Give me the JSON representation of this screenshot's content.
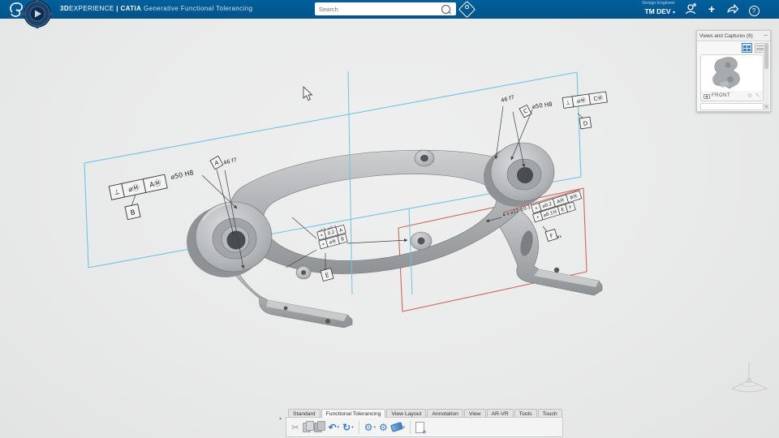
{
  "topbar": {
    "brand_bold": "3D",
    "brand_rest": "EXPERIENCE",
    "pipe": "|",
    "app": "CATIA",
    "module": "Generative Functional Tolerancing",
    "search_placeholder": "Search",
    "user_role": "Design Engineer",
    "user_name": "TM DEV",
    "user_caret": "▾"
  },
  "views_panel": {
    "title": "Views and Captures (6)",
    "minimize_glyph": "–",
    "capture_label": "FRONT",
    "scroll_down_glyph": "▾"
  },
  "ribbon": {
    "tabs": [
      "Standard",
      "Functional Tolerancing",
      "View Layout",
      "Annotation",
      "View",
      "AR-VR",
      "Tools",
      "Touch"
    ],
    "active_tab": "Functional Tolerancing",
    "collapse_glyph": "▾",
    "icons": {
      "cut_glyph": "✂",
      "undo_glyph": "↶",
      "update_glyph": "↻",
      "gear1_glyph": "⚙",
      "gear2_glyph": "⚙",
      "dropdown_glyph": "▾"
    }
  },
  "annotations": {
    "left_fcf": {
      "c1": "⊥",
      "c2": "⌀Ⓜ",
      "c3": "AⓂ",
      "dim": "⌀50 H8",
      "flag": "B"
    },
    "left_datum": {
      "dim": "46 f7",
      "flag": "A"
    },
    "mid_fcf": {
      "dim": "⌀12 ±0.1",
      "r1c1": "⌖",
      "r1c2": "0.2",
      "r1c3": "A",
      "r2c1": "⌖",
      "r2c2": "⌀Ⓜ",
      "r2c3": "B",
      "flag": "E"
    },
    "right_datum": {
      "dim": "46 f7",
      "flag": "C"
    },
    "right_top_fcf": {
      "dim": "⌀50 H8",
      "c1": "⊥",
      "c2": "⌀Ⓜ",
      "c3": "CⓂ",
      "flag": "D"
    },
    "right_fcf": {
      "note": "4 x ⌀12 ±0.1",
      "r1c1": "⌖",
      "r1c2": "⌀0.2",
      "r1c3": "AⓂ",
      "r1c4": "BⓂ",
      "r2c1": "⌖",
      "r2c2": "⌀0.1Ⓜ",
      "r2c3": "E",
      "r2c4": "F",
      "flag": "F",
      "flag_note": "4x"
    }
  },
  "colors": {
    "topbar_blue": "#00528a",
    "accent_blue": "#3a7bbf",
    "plane_cyan": "#6fc3e4",
    "plane_red": "#cd675c"
  }
}
